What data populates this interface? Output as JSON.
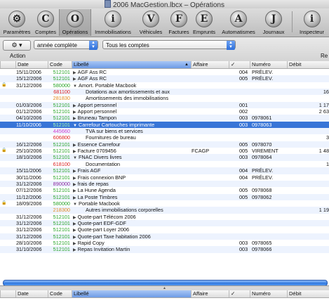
{
  "window": {
    "title": "2006 MacGestion.lbcx – Opérations"
  },
  "toolbar": {
    "items": [
      {
        "label": "Paramètres",
        "glyph": "⚙"
      },
      {
        "label": "Comptes",
        "glyph": "C"
      },
      {
        "label": "Opérations",
        "glyph": "O"
      },
      {
        "label": "Immobilisations",
        "glyph": "i"
      },
      {
        "label": "Véhicules",
        "glyph": "V"
      },
      {
        "label": "Factures",
        "glyph": "F"
      },
      {
        "label": "Emprunts",
        "glyph": "E"
      },
      {
        "label": "Automatismes",
        "glyph": "A"
      },
      {
        "label": "Journaux",
        "glyph": "J"
      },
      {
        "label": "Inspecteur",
        "glyph": "i"
      }
    ]
  },
  "filterbar": {
    "action_icon": "⚙ ▾",
    "action_label": "Action",
    "period_select": "année complète",
    "account_select": "Tous les comptes",
    "right_label": "Re"
  },
  "table": {
    "headers": {
      "date": "Date",
      "code": "Code",
      "libelle": "Libellé",
      "affaire": "Affaire",
      "check": "✓",
      "numero": "Numéro",
      "debit": "Débit"
    },
    "rows": [
      {
        "lock": "",
        "date": "15/11/2006",
        "code": "512101",
        "code_color": "green",
        "tri": "▶",
        "libelle": "AGF Ass RC",
        "affaire": "",
        "check": "on",
        "journal": "004",
        "numero": "PRÉLEV.",
        "debit": ""
      },
      {
        "lock": "",
        "date": "15/12/2006",
        "code": "512101",
        "code_color": "green",
        "tri": "▶",
        "libelle": "AGF Ass RC",
        "affaire": "",
        "check": "on",
        "journal": "005",
        "numero": "PRÉLEV.",
        "debit": ""
      },
      {
        "lock": "🔒",
        "date": "31/12/2006",
        "code": "580000",
        "code_color": "green",
        "tri": "▼",
        "libelle": "Amort. Portable Macbook",
        "affaire": "",
        "check": "off",
        "journal": "",
        "numero": "",
        "debit": ""
      },
      {
        "lock": "",
        "date": "",
        "code": "681100",
        "code_color": "red",
        "tri": "",
        "libelle": "Dotations aux amortissements et aux",
        "affaire": "",
        "check": "off",
        "journal": "",
        "numero": "",
        "debit": "16"
      },
      {
        "lock": "",
        "date": "",
        "code": "281830",
        "code_color": "orange",
        "tri": "",
        "libelle": "Amortissements des immobilisations",
        "affaire": "",
        "check": "off",
        "journal": "",
        "numero": "",
        "debit": ""
      },
      {
        "lock": "",
        "date": "01/03/2006",
        "code": "512101",
        "code_color": "green",
        "tri": "▶",
        "libelle": "Apport personnel",
        "affaire": "",
        "check": "on",
        "journal": "001",
        "numero": "",
        "debit": "1 17"
      },
      {
        "lock": "",
        "date": "01/12/2006",
        "code": "512101",
        "code_color": "green",
        "tri": "▶",
        "libelle": "Apport personnel",
        "affaire": "",
        "check": "on",
        "journal": "002",
        "numero": "",
        "debit": "2 63"
      },
      {
        "lock": "",
        "date": "04/10/2006",
        "code": "512101",
        "code_color": "green",
        "tri": "▶",
        "libelle": "Bruneau Tampon",
        "affaire": "",
        "check": "on",
        "journal": "003",
        "numero": "0978061",
        "debit": ""
      },
      {
        "lock": "",
        "date": "11/10/2006",
        "code": "512101",
        "code_color": "green",
        "tri": "▼",
        "libelle": "Carrefour Cartouches imprimante",
        "affaire": "",
        "check": "on",
        "journal": "003",
        "numero": "0978063",
        "debit": "",
        "selected": true
      },
      {
        "lock": "",
        "date": "",
        "code": "445660",
        "code_color": "pink",
        "tri": "",
        "libelle": "TVA sur biens et services",
        "affaire": "",
        "check": "off",
        "journal": "",
        "numero": "",
        "debit": ""
      },
      {
        "lock": "",
        "date": "",
        "code": "606800",
        "code_color": "red",
        "tri": "",
        "libelle": "Fournitures de bureau",
        "affaire": "",
        "check": "off",
        "journal": "",
        "numero": "",
        "debit": "3"
      },
      {
        "lock": "",
        "date": "16/12/2006",
        "code": "512101",
        "code_color": "green",
        "tri": "▶",
        "libelle": "Essence Carrefour",
        "affaire": "",
        "check": "on",
        "journal": "005",
        "numero": "0978070",
        "debit": ""
      },
      {
        "lock": "🔒",
        "date": "25/10/2006",
        "code": "512101",
        "code_color": "green",
        "tri": "▶",
        "libelle": "Facture 0709456",
        "affaire": "FCAGP",
        "check": "on",
        "journal": "005",
        "numero": "VIREMENT",
        "debit": "1 48"
      },
      {
        "lock": "",
        "date": "18/10/2006",
        "code": "512101",
        "code_color": "green",
        "tri": "▼",
        "libelle": "FNAC Divers livres",
        "affaire": "",
        "check": "on",
        "journal": "003",
        "numero": "0978064",
        "debit": ""
      },
      {
        "lock": "",
        "date": "",
        "code": "618100",
        "code_color": "red",
        "tri": "",
        "libelle": "Documentation",
        "affaire": "",
        "check": "off",
        "journal": "",
        "numero": "",
        "debit": "1"
      },
      {
        "lock": "",
        "date": "15/11/2006",
        "code": "512101",
        "code_color": "green",
        "tri": "▶",
        "libelle": "Frais AGF",
        "affaire": "",
        "check": "on",
        "journal": "004",
        "numero": "PRÉLEV.",
        "debit": ""
      },
      {
        "lock": "",
        "date": "30/11/2006",
        "code": "512101",
        "code_color": "green",
        "tri": "▶",
        "libelle": "Frais connexion BNP",
        "affaire": "",
        "check": "on",
        "journal": "004",
        "numero": "PRÉLEV.",
        "debit": ""
      },
      {
        "lock": "",
        "date": "31/12/2006",
        "code": "890000",
        "code_color": "purple",
        "tri": "▶",
        "libelle": "frais de repas",
        "affaire": "",
        "check": "off",
        "journal": "",
        "numero": "",
        "debit": ""
      },
      {
        "lock": "",
        "date": "07/12/2006",
        "code": "512101",
        "code_color": "green",
        "tri": "▶",
        "libelle": "La Hune Agenda",
        "affaire": "",
        "check": "on",
        "journal": "005",
        "numero": "0978068",
        "debit": ""
      },
      {
        "lock": "",
        "date": "11/12/2006",
        "code": "512101",
        "code_color": "green",
        "tri": "▶",
        "libelle": "La Poste Timbres",
        "affaire": "",
        "check": "on",
        "journal": "005",
        "numero": "0978062",
        "debit": ""
      },
      {
        "lock": "🔒",
        "date": "18/09/2006",
        "code": "580000",
        "code_color": "green",
        "tri": "▼",
        "libelle": "Portable Macbook",
        "affaire": "",
        "check": "off",
        "journal": "",
        "numero": "",
        "debit": ""
      },
      {
        "lock": "",
        "date": "",
        "code": "218300",
        "code_color": "orange",
        "tri": "",
        "libelle": "Autres immobilisations corporelles",
        "affaire": "",
        "check": "off",
        "journal": "",
        "numero": "",
        "debit": "1 19"
      },
      {
        "lock": "",
        "date": "31/12/2006",
        "code": "512101",
        "code_color": "green",
        "tri": "▶",
        "libelle": "Quote-part Télécom 2006",
        "affaire": "",
        "check": "off",
        "journal": "",
        "numero": "",
        "debit": ""
      },
      {
        "lock": "",
        "date": "31/12/2006",
        "code": "512101",
        "code_color": "green",
        "tri": "▶",
        "libelle": "Quote-part EDF-GDF",
        "affaire": "",
        "check": "off",
        "journal": "",
        "numero": "",
        "debit": ""
      },
      {
        "lock": "",
        "date": "31/12/2006",
        "code": "512101",
        "code_color": "green",
        "tri": "▶",
        "libelle": "Quote-part Loyer 2006",
        "affaire": "",
        "check": "off",
        "journal": "",
        "numero": "",
        "debit": ""
      },
      {
        "lock": "",
        "date": "31/12/2006",
        "code": "512101",
        "code_color": "green",
        "tri": "▶",
        "libelle": "Quote-part Taxe habitation 2006",
        "affaire": "",
        "check": "off",
        "journal": "",
        "numero": "",
        "debit": ""
      },
      {
        "lock": "",
        "date": "28/10/2006",
        "code": "512101",
        "code_color": "green",
        "tri": "▶",
        "libelle": "Rapid Copy",
        "affaire": "",
        "check": "on",
        "journal": "003",
        "numero": "0978065",
        "debit": ""
      },
      {
        "lock": "",
        "date": "31/10/2006",
        "code": "512101",
        "code_color": "green",
        "tri": "▶",
        "libelle": "Repas Invitation Martin",
        "affaire": "",
        "check": "on",
        "journal": "003",
        "numero": "0978066",
        "debit": ""
      }
    ]
  },
  "colors": {
    "selection": "#3875d7",
    "alt_row": "#edf3fe",
    "accent": "#2f78e0"
  }
}
